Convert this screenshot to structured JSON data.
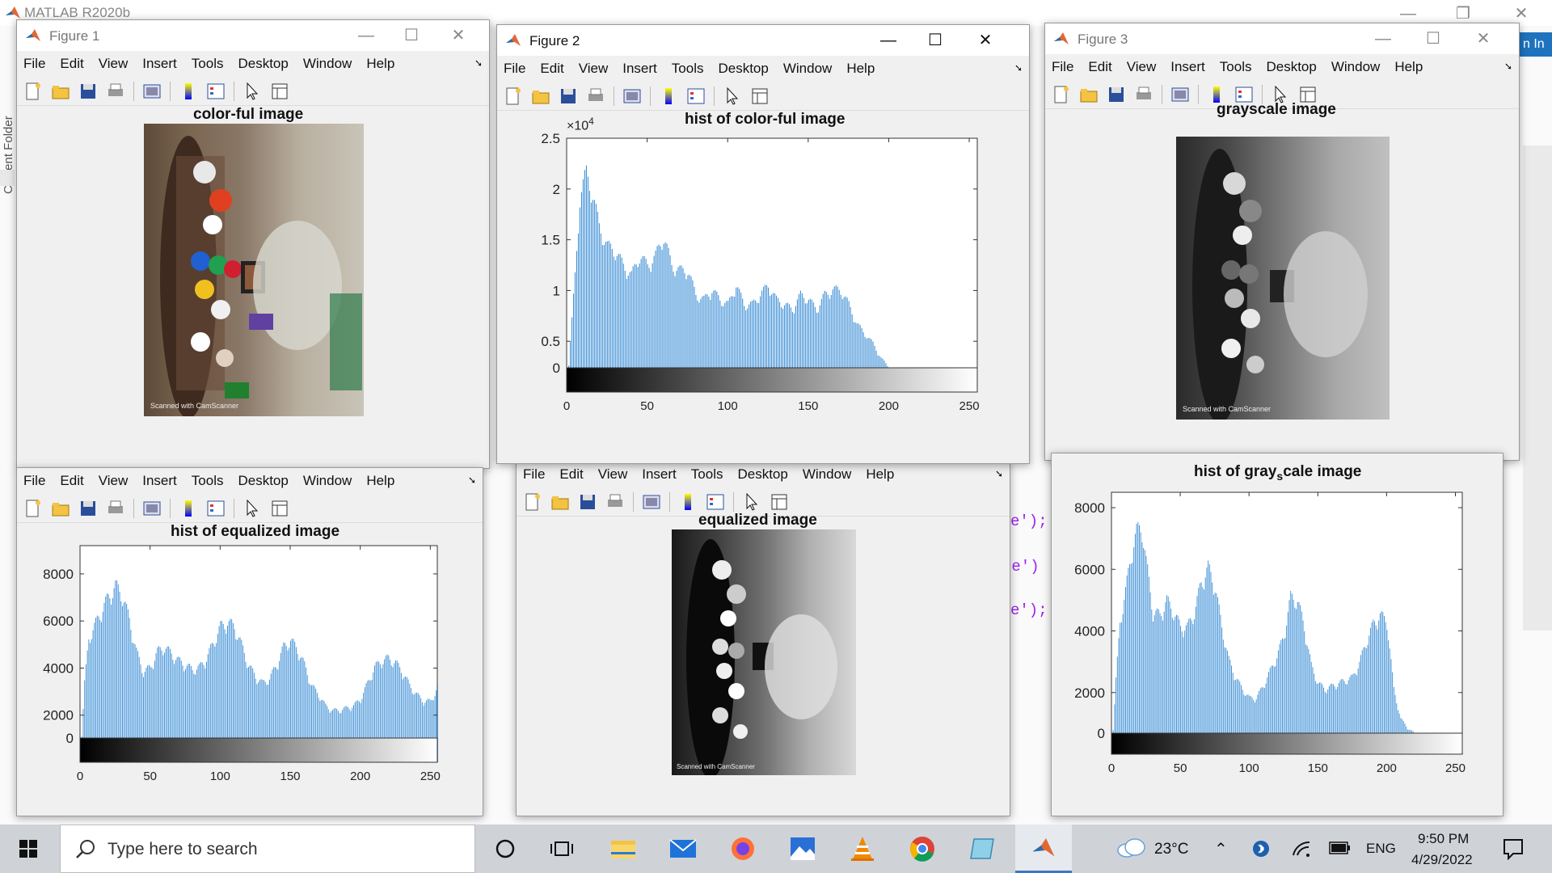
{
  "app": {
    "title": "MATLAB R2020b",
    "sign_in": "n In",
    "side_panel": "Current Folder"
  },
  "code_lines": [
    "e');",
    "ge')",
    "e');"
  ],
  "menu": [
    "File",
    "Edit",
    "View",
    "Insert",
    "Tools",
    "Desktop",
    "Window",
    "Help"
  ],
  "figures": {
    "fig1": {
      "title": "Figure 1",
      "plot_title": "color-ful image"
    },
    "fig2": {
      "title": "Figure 2",
      "plot_title": "hist of color-ful image",
      "exponent": "×10",
      "exponent_power": "4"
    },
    "fig3": {
      "title": "Figure 3",
      "plot_title": "grayscale image"
    },
    "fig4": {
      "plot_title": "hist of equalized image"
    },
    "fig5": {
      "plot_title": "equalized image"
    },
    "fig6": {
      "plot_title_a": "hist of gray",
      "plot_title_sub": "s",
      "plot_title_b": "cale image"
    }
  },
  "watermark": "Scanned with CamScanner",
  "chart_data": [
    {
      "type": "bar",
      "title": "hist of color-ful image",
      "xlim": [
        0,
        255
      ],
      "ylim": [
        0,
        25000
      ],
      "x_ticks": [
        0,
        50,
        100,
        150,
        200,
        250
      ],
      "y_ticks": [
        0,
        0.5,
        1,
        1.5,
        2,
        2.5
      ],
      "y_tick_labels": [
        "0",
        "0.5",
        "1",
        "1.5",
        "2",
        "2.5"
      ],
      "y_multiplier": "×10^4",
      "colorbar": "grayscale 0-255",
      "x": [
        0,
        5,
        8,
        12,
        15,
        20,
        25,
        30,
        35,
        40,
        45,
        50,
        55,
        60,
        65,
        70,
        75,
        80,
        85,
        90,
        95,
        100,
        105,
        110,
        115,
        120,
        125,
        130,
        135,
        140,
        145,
        150,
        155,
        160,
        165,
        170,
        175,
        180,
        185,
        190,
        195,
        200,
        205,
        210,
        215,
        220,
        225,
        230,
        235,
        240,
        245,
        250,
        255
      ],
      "values": [
        500,
        12000,
        20000,
        22500,
        21000,
        17000,
        15000,
        14500,
        13000,
        12000,
        14000,
        13000,
        14000,
        16000,
        13000,
        12500,
        12500,
        10000,
        9500,
        10500,
        9500,
        9000,
        11000,
        9000,
        9000,
        10000,
        11000,
        9500,
        9000,
        8500,
        10000,
        9500,
        8500,
        10000,
        10500,
        10500,
        9000,
        7000,
        6000,
        5000,
        3500,
        2500,
        2000,
        1500,
        1000,
        700,
        400,
        300,
        200,
        150,
        100,
        50,
        0
      ]
    },
    {
      "type": "bar",
      "title": "hist of equalized image",
      "xlim": [
        0,
        255
      ],
      "ylim": [
        0,
        9200
      ],
      "x_ticks": [
        0,
        50,
        100,
        150,
        200,
        250
      ],
      "y_ticks": [
        0,
        2000,
        4000,
        6000,
        8000
      ],
      "colorbar": "grayscale 0-255",
      "x": [
        0,
        3,
        6,
        10,
        15,
        20,
        25,
        30,
        35,
        40,
        45,
        50,
        55,
        60,
        65,
        70,
        75,
        80,
        85,
        90,
        95,
        100,
        105,
        110,
        115,
        120,
        125,
        130,
        135,
        140,
        145,
        150,
        155,
        160,
        165,
        170,
        175,
        180,
        185,
        190,
        195,
        200,
        205,
        210,
        215,
        220,
        225,
        230,
        235,
        240,
        245,
        250,
        255
      ],
      "values": [
        0,
        3500,
        5500,
        6000,
        6700,
        7300,
        7800,
        7400,
        6300,
        4900,
        4000,
        4200,
        4900,
        5100,
        4800,
        4500,
        4300,
        4100,
        4200,
        4600,
        5300,
        6000,
        6200,
        6000,
        5200,
        4300,
        3800,
        3500,
        3700,
        4300,
        5100,
        5400,
        5000,
        4300,
        3400,
        3000,
        2500,
        2300,
        2300,
        2400,
        2500,
        2800,
        3500,
        4200,
        4500,
        4600,
        4400,
        4000,
        3400,
        3000,
        2700,
        2700,
        3300
      ]
    },
    {
      "type": "bar",
      "title": "hist of grayscale image",
      "xlim": [
        0,
        255
      ],
      "ylim": [
        0,
        8500
      ],
      "x_ticks": [
        0,
        50,
        100,
        150,
        200,
        250
      ],
      "y_ticks": [
        0,
        2000,
        4000,
        6000,
        8000
      ],
      "colorbar": "grayscale 0-255",
      "x": [
        0,
        3,
        6,
        10,
        15,
        18,
        22,
        25,
        30,
        35,
        40,
        45,
        50,
        55,
        60,
        65,
        70,
        75,
        80,
        85,
        90,
        95,
        100,
        105,
        110,
        115,
        120,
        125,
        130,
        135,
        140,
        145,
        150,
        155,
        160,
        165,
        170,
        175,
        180,
        185,
        190,
        195,
        200,
        205,
        210,
        215,
        220,
        225,
        230,
        235,
        240,
        245,
        250,
        255
      ],
      "values": [
        0,
        2500,
        4500,
        5500,
        7000,
        7500,
        7700,
        6500,
        4800,
        4700,
        5200,
        4800,
        4300,
        4300,
        4800,
        5800,
        6300,
        5700,
        4300,
        3200,
        2600,
        2200,
        1900,
        1900,
        2300,
        2800,
        3300,
        4000,
        5300,
        5200,
        4300,
        3000,
        2400,
        2200,
        2300,
        2400,
        2500,
        2600,
        3100,
        3800,
        4400,
        4700,
        4500,
        2200,
        1200,
        900,
        700,
        500,
        300,
        200,
        150,
        100,
        50,
        20
      ]
    }
  ]
}
